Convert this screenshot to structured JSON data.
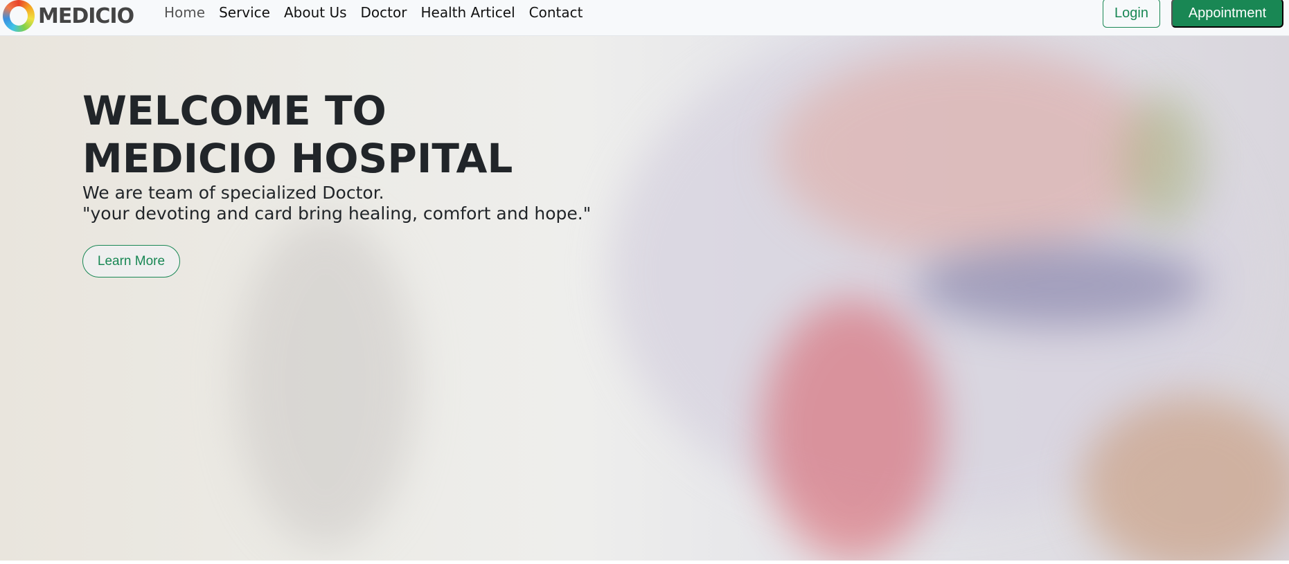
{
  "brand": {
    "name": "MEDICIO"
  },
  "nav": {
    "items": [
      {
        "label": "Home",
        "active": true
      },
      {
        "label": "Service"
      },
      {
        "label": "About Us"
      },
      {
        "label": "Doctor"
      },
      {
        "label": "Health Articel"
      },
      {
        "label": "Contact"
      }
    ],
    "login": "Login",
    "appointment": "Appointment"
  },
  "hero": {
    "title": "WELCOME TO MEDICIO HOSPITAL",
    "line1": "We are team of specialized Doctor.",
    "line2": "\"your devoting and card bring healing, comfort and hope.\"",
    "button": "Learn More"
  },
  "colors": {
    "accent": "#198754",
    "text": "#212529"
  }
}
